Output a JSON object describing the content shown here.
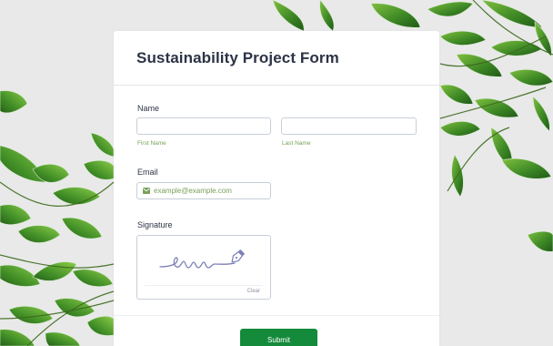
{
  "form": {
    "title": "Sustainability Project Form"
  },
  "fields": {
    "name": {
      "label": "Name",
      "first_sublabel": "First Name",
      "last_sublabel": "Last Name",
      "first_value": "",
      "last_value": ""
    },
    "email": {
      "label": "Email",
      "placeholder": "example@example.com",
      "icon": "envelope-icon"
    },
    "signature": {
      "label": "Signature",
      "clear_label": "Clear",
      "icon": "pen-signature-icon"
    }
  },
  "submit": {
    "label": "Submit"
  },
  "colors": {
    "accent_green": "#148a3b",
    "sublabel_green": "#78a05a",
    "title": "#2c3345",
    "signature_icon": "#7b7fb5",
    "background": "#e9e9e9"
  }
}
